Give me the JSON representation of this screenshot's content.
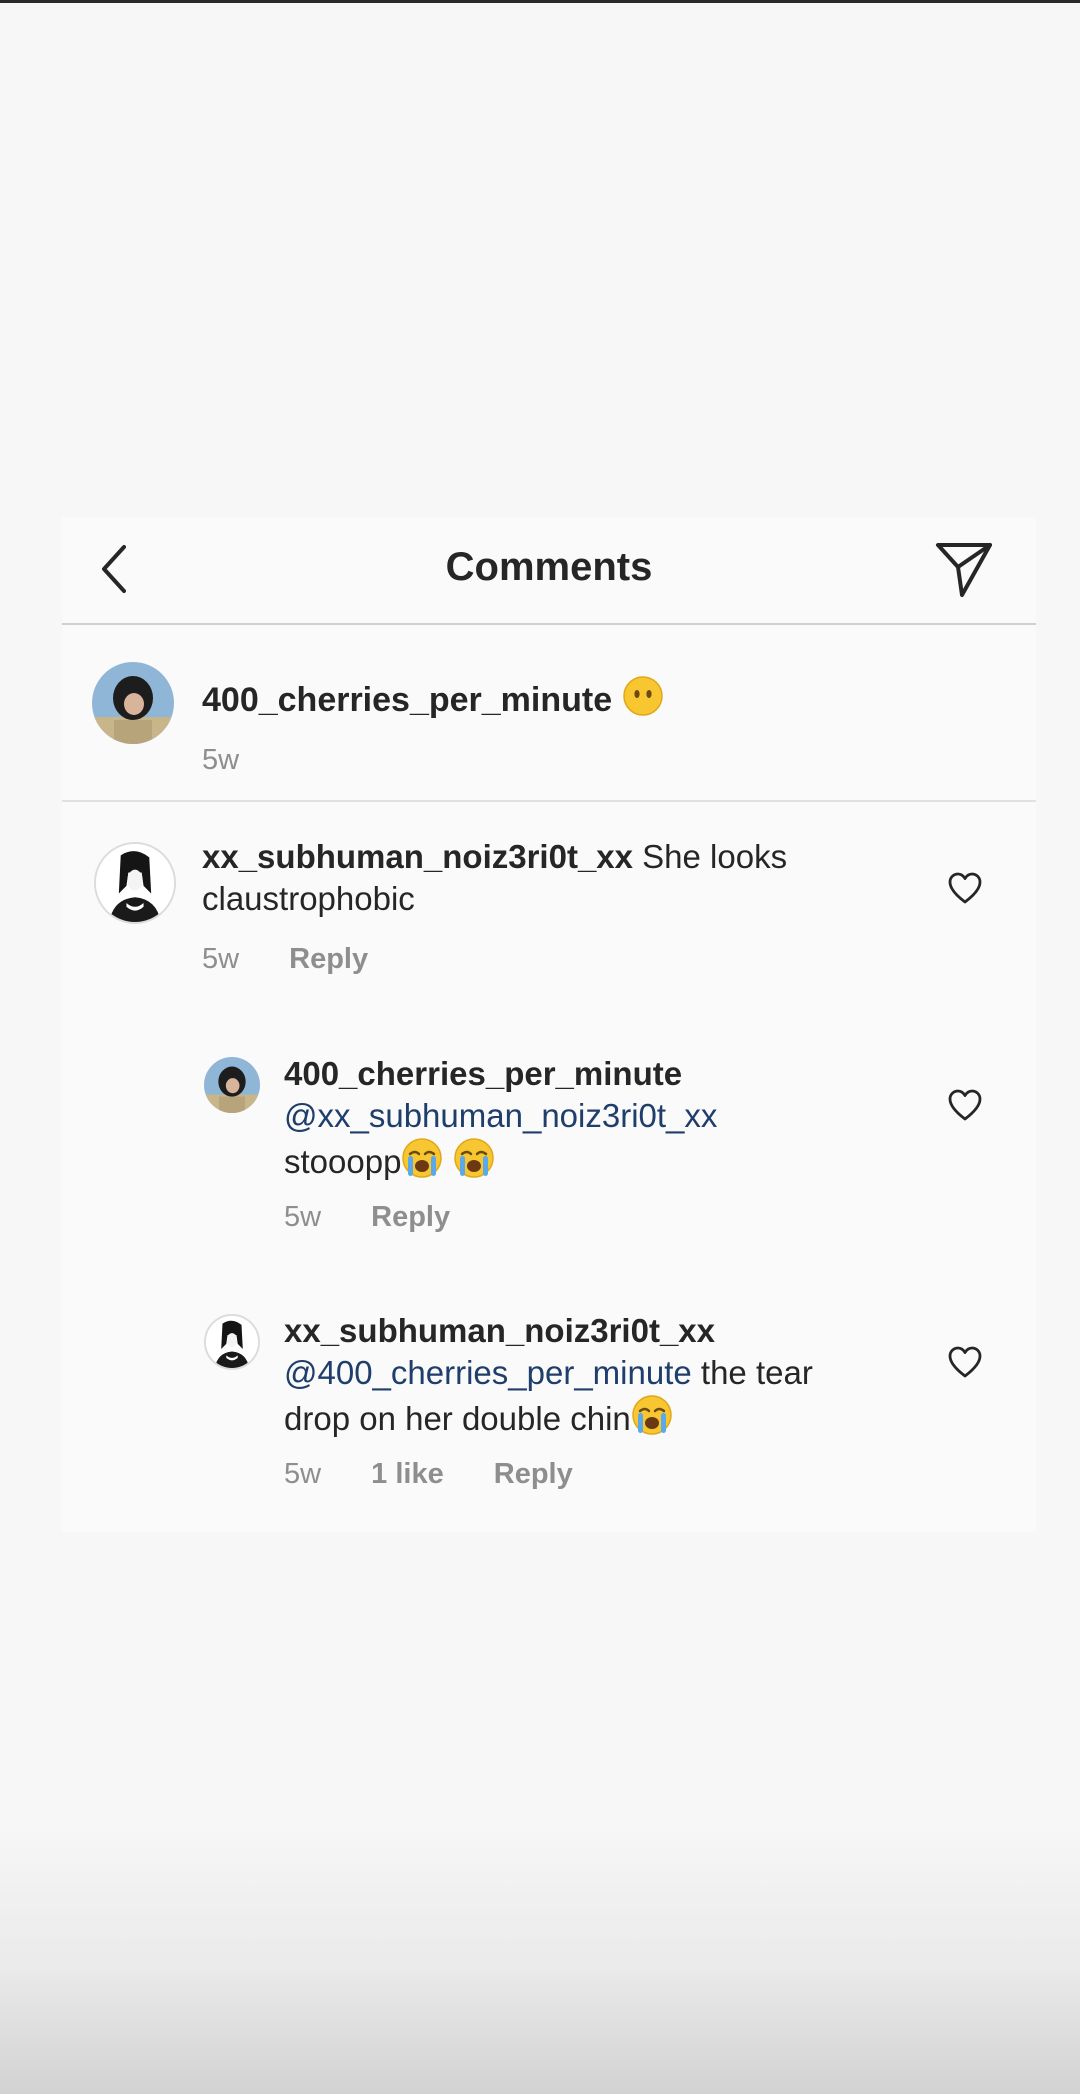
{
  "header": {
    "title": "Comments"
  },
  "caption": {
    "username": "400_cherries_per_minute",
    "time": "5w"
  },
  "comments": [
    {
      "username": "xx_subhuman_noiz3ri0t_xx",
      "text_line1": "She looks",
      "text_line2": "claustrophobic",
      "time": "5w",
      "reply_label": "Reply"
    },
    {
      "username": "400_cherries_per_minute",
      "mention": "@xx_subhuman_noiz3ri0t_xx",
      "text": "stooopp",
      "time": "5w",
      "reply_label": "Reply"
    },
    {
      "username": "xx_subhuman_noiz3ri0t_xx",
      "mention": "@400_cherries_per_minute",
      "text_line1": "the tear",
      "text_line2": "drop on her double chin",
      "time": "5w",
      "likes": "1 like",
      "reply_label": "Reply"
    }
  ],
  "icons": {
    "back": "chevron-left-icon",
    "share": "paper-plane-icon",
    "like": "heart-outline-icon",
    "caption_emoji": "no-mouth-face-emoji",
    "reply_emoji": "loudly-crying-face-emoji"
  },
  "colors": {
    "mention": "#1f3e6b",
    "secondary_text": "#8e8e8e",
    "primary_text": "#262626"
  }
}
